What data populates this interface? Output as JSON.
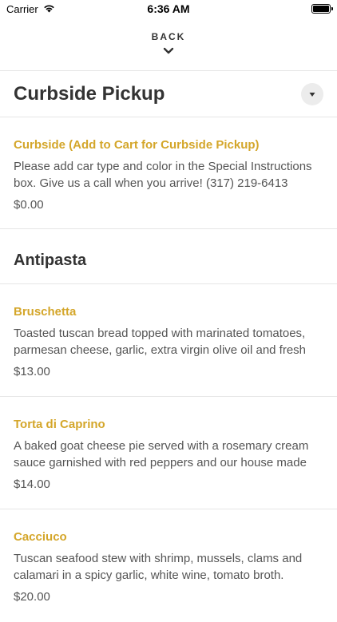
{
  "status_bar": {
    "carrier": "Carrier",
    "time": "6:36 AM",
    "wifi_icon": "wifi-icon",
    "battery_icon": "battery-icon"
  },
  "navigation": {
    "back_label": "BACK",
    "chevron_icon": "chevron-down-icon"
  },
  "sections": [
    {
      "title": "Curbside Pickup",
      "collapse_icon": "caret-down-icon",
      "items": [
        {
          "name": "Curbside (Add to Cart for Curbside Pickup)",
          "description": "Please add car type and color in the Special Instructions box. Give us a call when you arrive! (317) 219-6413",
          "price": "$0.00"
        }
      ]
    },
    {
      "title": "Antipasta",
      "items": [
        {
          "name": "Bruschetta",
          "description": "Toasted tuscan bread topped with marinated tomatoes, parmesan cheese, garlic, extra virgin olive oil and fresh",
          "price": "$13.00"
        },
        {
          "name": "Torta di Caprino",
          "description": "A baked goat cheese pie served with a rosemary cream sauce garnished with red peppers and our house made",
          "price": "$14.00"
        },
        {
          "name": "Cacciuco",
          "description": "Tuscan seafood stew with shrimp, mussels, clams and calamari in a spicy garlic, white wine, tomato broth.",
          "price": "$20.00"
        }
      ]
    }
  ],
  "colors": {
    "item_name": "#d4a62a",
    "text": "#333333",
    "divider": "#e6e6e6"
  }
}
